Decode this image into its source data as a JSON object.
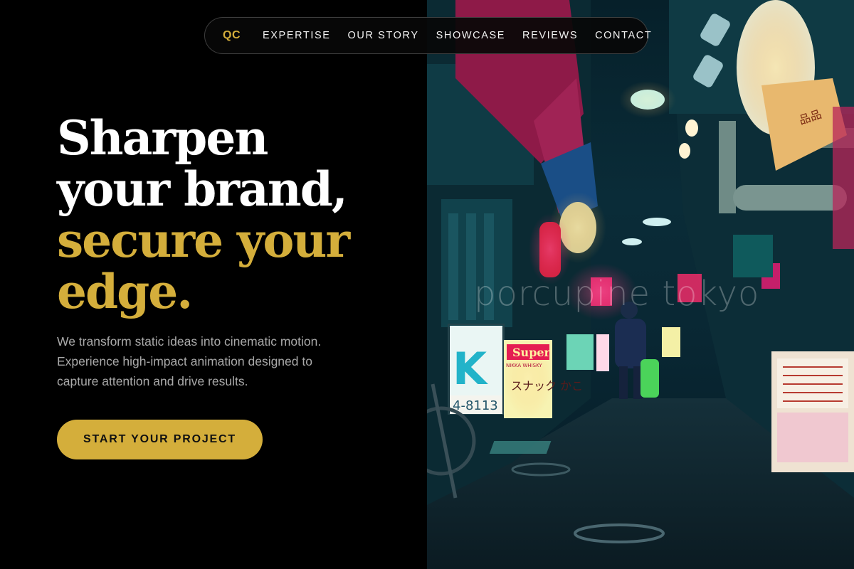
{
  "nav": {
    "logo": "QC",
    "links": [
      "EXPERTISE",
      "OUR STORY",
      "SHOWCASE",
      "REVIEWS",
      "CONTACT"
    ]
  },
  "hero": {
    "title_lines": [
      "Sharpen",
      "your brand,"
    ],
    "title_accent_lines": [
      "secure your",
      "edge."
    ],
    "subtitle_lines": [
      "We transform static ideas into cinematic motion.",
      "Experience high-impact animation designed to",
      "capture attention and drive results."
    ],
    "cta_label": "START YOUR PROJECT"
  },
  "photo": {
    "watermark": "porcupine tokyo",
    "sign_brand": "Super",
    "sign_sub": "NIKKA WHISKY",
    "sign_jp": "スナック かこ",
    "sign_phone": "4-8113",
    "sign_letter": "K"
  },
  "colors": {
    "background": "#000000",
    "accent": "#d4ae3b",
    "text_primary": "#ffffff",
    "text_muted": "#a9a9a9"
  }
}
